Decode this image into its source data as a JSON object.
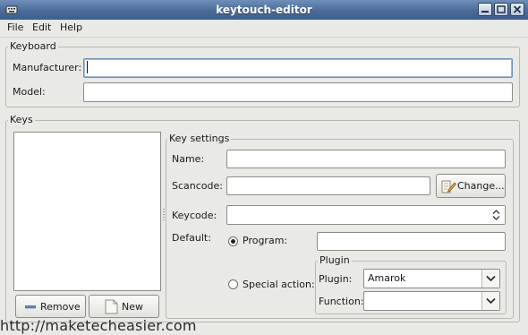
{
  "window": {
    "title": "keytouch-editor"
  },
  "menu": {
    "file": "File",
    "edit": "Edit",
    "help": "Help"
  },
  "keyboard": {
    "section_label": "Keyboard",
    "manufacturer_label": "Manufacturer:",
    "manufacturer_value": "",
    "model_label": "Model:",
    "model_value": ""
  },
  "keys": {
    "section_label": "Keys",
    "remove_button": "Remove",
    "new_button": "New"
  },
  "key_settings": {
    "section_label": "Key settings",
    "name_label": "Name:",
    "name_value": "",
    "scancode_label": "Scancode:",
    "scancode_value": "",
    "change_button": "Change...",
    "keycode_label": "Keycode:",
    "keycode_value": "",
    "default_label": "Default:",
    "program_option": "Program:",
    "program_selected": true,
    "program_value": "",
    "special_action_option": "Special action:",
    "plugin_group_label": "Plugin",
    "plugin_label": "Plugin:",
    "plugin_value": "Amarok",
    "function_label": "Function:",
    "function_value": ""
  },
  "watermark": "http://maketecheasier.com",
  "colors": {
    "titlebar": "#4a6b97",
    "focus_border": "#6d8fbd"
  }
}
